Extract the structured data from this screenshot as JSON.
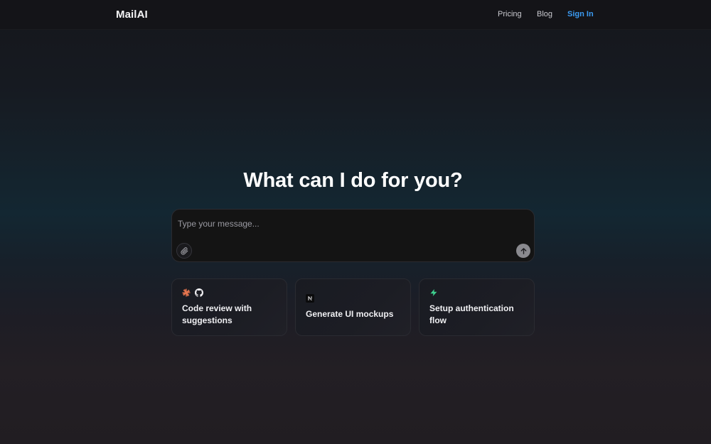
{
  "header": {
    "logo": "MailAI",
    "nav": {
      "pricing": "Pricing",
      "blog": "Blog",
      "sign_in": "Sign In"
    }
  },
  "main": {
    "headline": "What can I do for you?",
    "composer": {
      "placeholder": "Type your message...",
      "value": "",
      "attach_icon": "paperclip-icon",
      "send_icon": "arrow-up-icon"
    },
    "suggestions": [
      {
        "label": "Code review with suggestions",
        "icons": [
          "claude-sparkle-icon",
          "github-icon"
        ]
      },
      {
        "label": "Generate UI mockups",
        "icons": [
          "next-logo-icon"
        ]
      },
      {
        "label": "Setup authentication flow",
        "icons": [
          "supabase-bolt-icon"
        ]
      }
    ]
  },
  "colors": {
    "accent": "#3b9bf3",
    "sparkle": "#e8764f",
    "bolt": "#3ecf8e",
    "background_top": "#15171c",
    "background_mid": "#132732",
    "background_bottom": "#211d22"
  }
}
